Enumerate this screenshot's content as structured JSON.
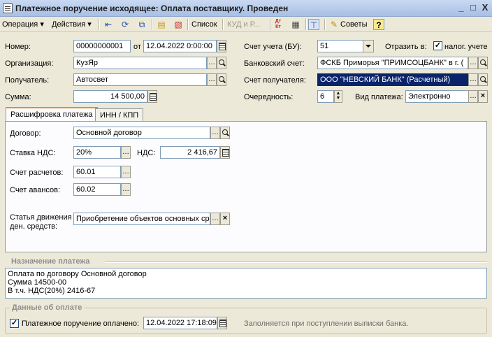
{
  "window": {
    "title": "Платежное поручение исходящее: Оплата поставщику. Проведен",
    "minimize": "_",
    "maximize": "□",
    "close": "X"
  },
  "toolbar": {
    "operation": "Операция ▾",
    "actions": "Действия ▾",
    "list": "Список",
    "kud": "КУД и Р...",
    "dtkt": "Дт Кт",
    "tips": "Советы",
    "help": "?"
  },
  "form": {
    "number_label": "Номер:",
    "number_value": "00000000001",
    "date_prefix": "от",
    "date_value": "12.04.2022  0:00:00",
    "account_bu_label": "Счет учета (БУ):",
    "account_bu_value": "51",
    "reflect_label": "Отразить в:",
    "tax_accounting_label": "налог. учете",
    "tax_accounting_checked": "✓",
    "organization_label": "Организация:",
    "organization_value": "КузЯр",
    "bank_account_label": "Банковский счет:",
    "bank_account_value": "ФСКБ Приморья \"ПРИМСОЦБАНК\" в г. (",
    "recipient_label": "Получатель:",
    "recipient_value": "Автосвет",
    "recipient_account_label": "Счет получателя:",
    "recipient_account_value": "ООО \"НЕВСКИЙ БАНК\" (Расчетный)",
    "amount_label": "Сумма:",
    "amount_value": "14 500,00",
    "priority_label": "Очередность:",
    "priority_value": "6",
    "payment_type_label": "Вид платежа:",
    "payment_type_value": "Электронно"
  },
  "tabs": [
    {
      "label": "Расшифровка платежа"
    },
    {
      "label": "ИНН / КПП"
    }
  ],
  "details": {
    "contract_label": "Договор:",
    "contract_value": "Основной договор",
    "vat_rate_label": "Ставка НДС:",
    "vat_rate_value": "20%",
    "vat_label": "НДС:",
    "vat_value": "2 416,67",
    "settlement_account_label": "Счет расчетов:",
    "settlement_account_value": "60.01",
    "advance_account_label": "Счет авансов:",
    "advance_account_value": "60.02",
    "cashflow_label_1": "Статья движения",
    "cashflow_label_2": "ден. средств:",
    "cashflow_value": "Приобретение объектов основных ср"
  },
  "purpose": {
    "title": "Назначение платежа",
    "line1": "Оплата по договору Основной договор",
    "line2": "Сумма 14500-00",
    "line3": "В т.ч. НДС(20%) 2416-67"
  },
  "payment": {
    "title": "Данные об оплате",
    "paid_label": "Платежное поручение оплачено:",
    "paid_checked": "✓",
    "paid_date": "12.04.2022 17:18:09",
    "hint": "Заполняется при поступлении выписки банка."
  }
}
